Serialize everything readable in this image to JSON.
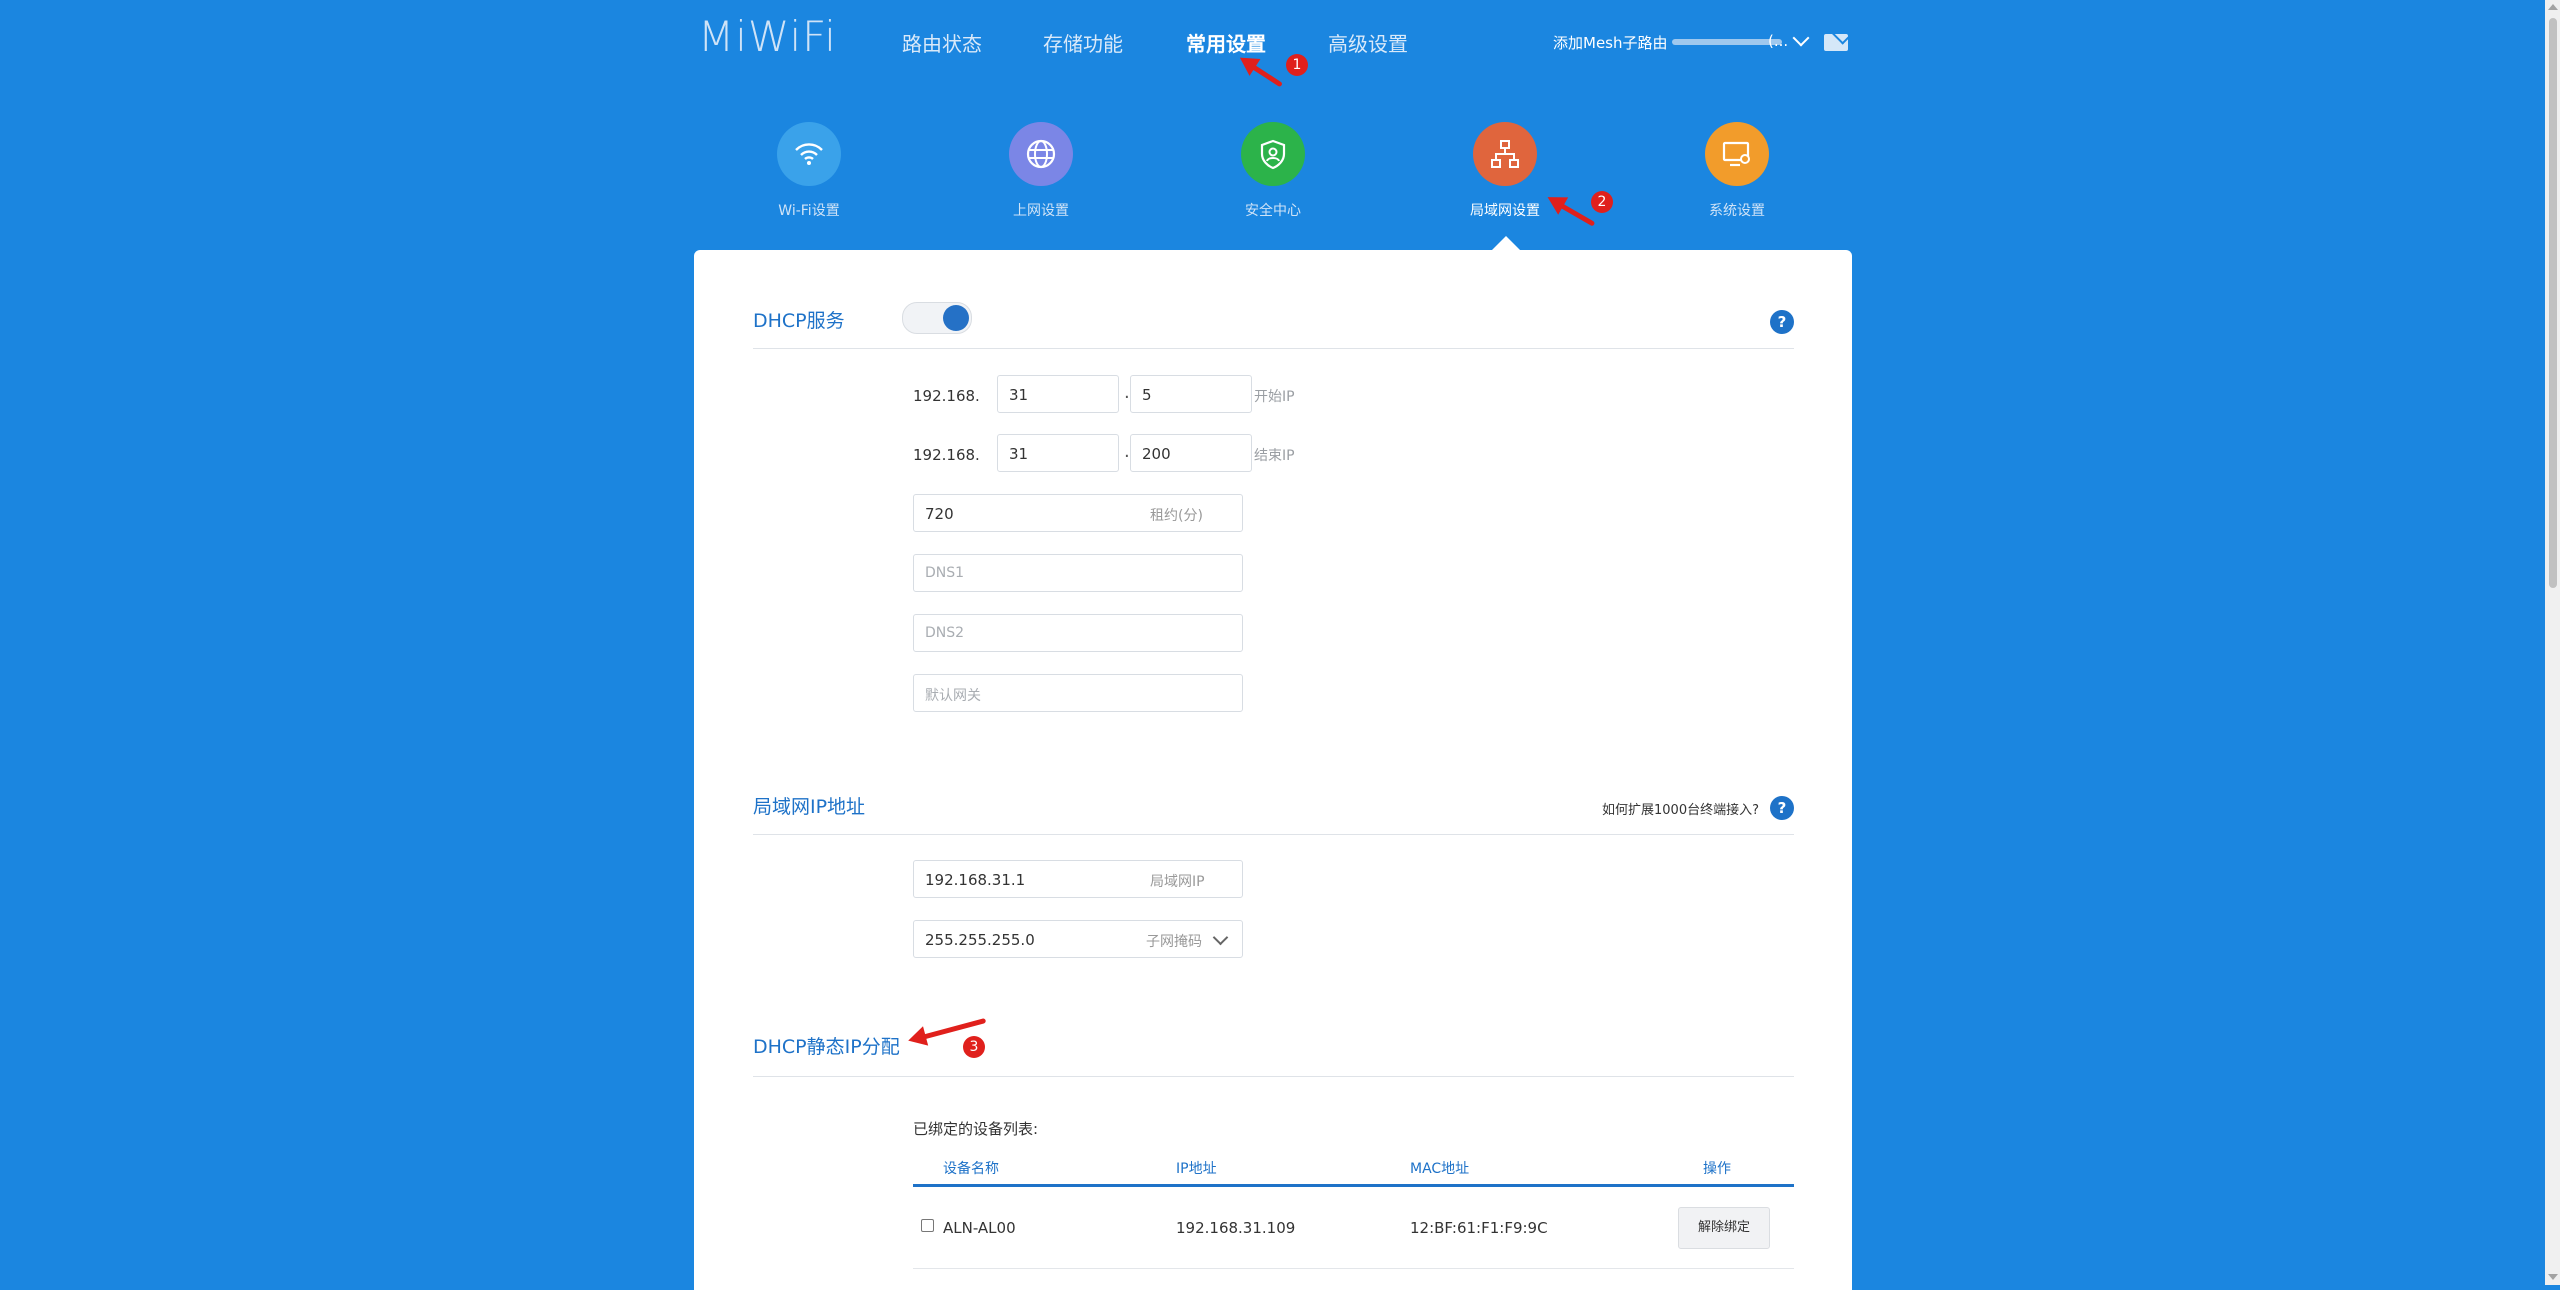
{
  "header": {
    "logo": "MiWiFi",
    "nav": [
      "路由状态",
      "存储功能",
      "常用设置",
      "高级设置"
    ],
    "active_nav": "常用设置",
    "add_mesh": "添加Mesh子路由",
    "account_suffix": "(..."
  },
  "categories": [
    {
      "label": "Wi-Fi设置",
      "color": "#3aa2ea",
      "icon": "wifi-icon"
    },
    {
      "label": "上网设置",
      "color": "#7b86e6",
      "icon": "globe-icon"
    },
    {
      "label": "安全中心",
      "color": "#2cb34a",
      "icon": "shield-icon"
    },
    {
      "label": "局域网设置",
      "color": "#e0653d",
      "icon": "lan-icon",
      "active": true
    },
    {
      "label": "系统设置",
      "color": "#f29c2b",
      "icon": "system-icon"
    }
  ],
  "annotations": [
    "1",
    "2",
    "3"
  ],
  "dhcp": {
    "title": "DHCP服务",
    "help": "?",
    "enabled": true,
    "prefix": "192.168.",
    "start_3": "31",
    "start_4": "5",
    "start_label": "开始IP",
    "end_3": "31",
    "end_4": "200",
    "end_label": "结束IP",
    "dot": ".",
    "lease": "720",
    "lease_label": "租约(分)",
    "dns1_placeholder": "DNS1",
    "dns2_placeholder": "DNS2",
    "gateway_placeholder": "默认网关"
  },
  "lan": {
    "title": "局域网IP地址",
    "help_text": "如何扩展1000台终端接入?",
    "ip": "192.168.31.1",
    "ip_label": "局域网IP",
    "mask": "255.255.255.0",
    "mask_label": "子网掩码"
  },
  "static": {
    "title": "DHCP静态IP分配",
    "list_title": "已绑定的设备列表:",
    "columns": [
      "设备名称",
      "IP地址",
      "MAC地址",
      "操作"
    ],
    "rows": [
      {
        "name": "ALN-AL00",
        "ip": "192.168.31.109",
        "mac": "12:BF:61:F1:F9:9C",
        "action": "解除绑定"
      }
    ]
  }
}
